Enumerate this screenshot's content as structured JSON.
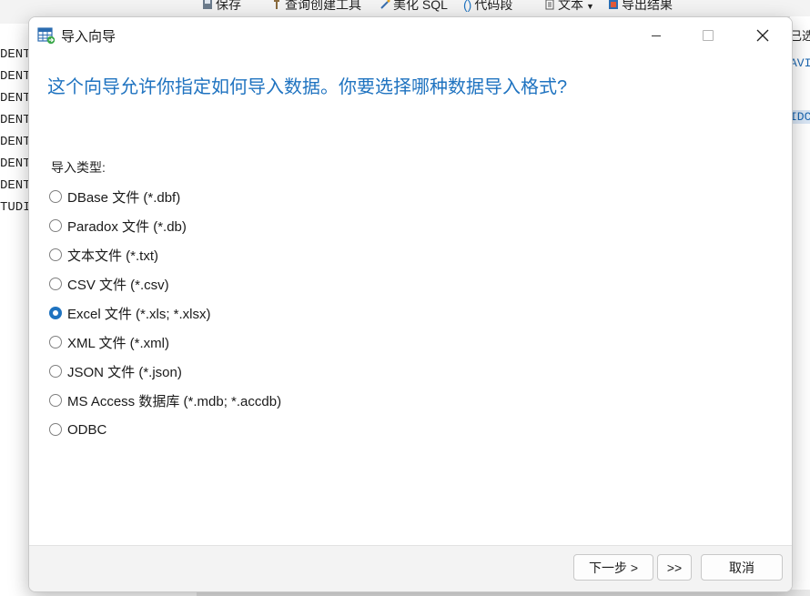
{
  "background_app": {
    "toolbar": {
      "save_label": "保存",
      "query_builder_label": "查询创建工具",
      "beautify_label": "美化 SQL",
      "snippet_label": "代码段",
      "text_label": "文本",
      "export_label": "导出结果"
    },
    "left_list": [
      "DENT",
      "DENT",
      "DENT",
      "DENT",
      "DENT",
      "DENT",
      "DENT",
      "TUDI"
    ],
    "right_fragments": [
      "已选",
      "AVI",
      "IDC"
    ]
  },
  "dialog": {
    "title": "导入向导",
    "heading": "这个向导允许你指定如何导入数据。你要选择哪种数据导入格式?",
    "group_label": "导入类型:",
    "options": [
      {
        "label": "DBase 文件 (*.dbf)",
        "checked": false
      },
      {
        "label": "Paradox 文件 (*.db)",
        "checked": false
      },
      {
        "label": "文本文件 (*.txt)",
        "checked": false
      },
      {
        "label": "CSV 文件 (*.csv)",
        "checked": false
      },
      {
        "label": "Excel 文件 (*.xls; *.xlsx)",
        "checked": true
      },
      {
        "label": "XML 文件 (*.xml)",
        "checked": false
      },
      {
        "label": "JSON 文件 (*.json)",
        "checked": false
      },
      {
        "label": "MS Access 数据库 (*.mdb; *.accdb)",
        "checked": false
      },
      {
        "label": "ODBC",
        "checked": false
      }
    ],
    "buttons": {
      "next": "下一步 >",
      "last": ">>",
      "cancel": "取消"
    }
  },
  "colors": {
    "accent": "#1f73c0",
    "dialog_bg": "#ffffff",
    "footer_bg": "#f3f3f3"
  }
}
